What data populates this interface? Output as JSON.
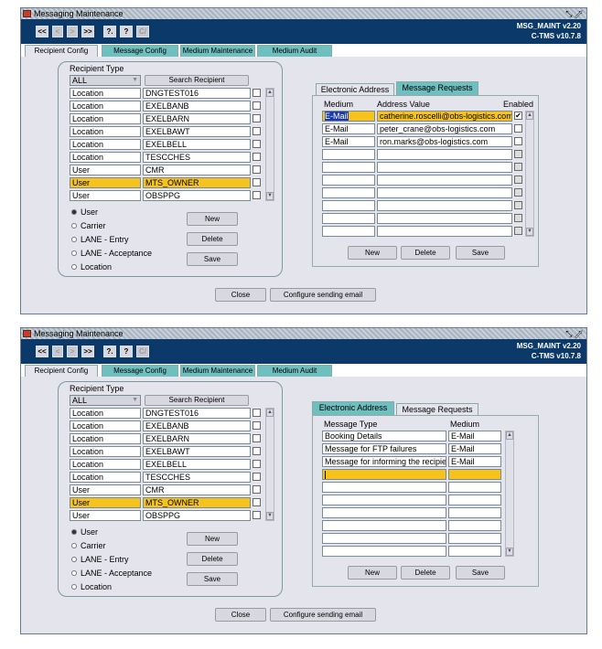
{
  "windows": [
    {
      "title": "Messaging Maintenance",
      "app_id": "MSG_MAINT v2.20",
      "app_version": "C-TMS v10.7.8",
      "toolbar_buttons": [
        "<<",
        "<",
        ">",
        ">>",
        "?.",
        "?",
        "C/"
      ],
      "tabs": [
        "Recipient Config",
        "Message Config",
        "Medium Maintenance",
        "Medium Audit"
      ],
      "recipient_type_label": "Recipient Type",
      "filter_value": "ALL",
      "search_button": "Search Recipient",
      "recipients": [
        {
          "type": "Location",
          "name": "DNGTEST016"
        },
        {
          "type": "Location",
          "name": "EXELBANB"
        },
        {
          "type": "Location",
          "name": "EXELBARN"
        },
        {
          "type": "Location",
          "name": "EXELBAWT"
        },
        {
          "type": "Location",
          "name": "EXELBELL"
        },
        {
          "type": "Location",
          "name": "TESCCHES"
        },
        {
          "type": "User",
          "name": "CMR"
        },
        {
          "type": "User",
          "name": "MTS_OWNER"
        },
        {
          "type": "User",
          "name": "OBSPPG"
        }
      ],
      "radios": [
        "User",
        "Carrier",
        "LANE - Entry",
        "LANE - Acceptance",
        "Location"
      ],
      "side_buttons": [
        "New",
        "Delete",
        "Save"
      ],
      "right_tabs": [
        "Electronic Address",
        "Message Requests"
      ],
      "right_headers": [
        "Medium",
        "Address Value",
        "Enabled"
      ],
      "right_rows": [
        {
          "c1": "E-Mail",
          "c2": "catherine.roscelli@obs-logistics.com"
        },
        {
          "c1": "E-Mail",
          "c2": "peter_crane@obs-logistics.com"
        },
        {
          "c1": "E-Mail",
          "c2": "ron.marks@obs-logistics.com"
        }
      ],
      "right_buttons": [
        "New",
        "Delete",
        "Save"
      ],
      "bottom_buttons": [
        "Close",
        "Configure sending email"
      ]
    },
    {
      "title": "Messaging Maintenance",
      "app_id": "MSG_MAINT v2.20",
      "app_version": "C-TMS v10.7.8",
      "toolbar_buttons": [
        "<<",
        "<",
        ">",
        ">>",
        "?.",
        "?",
        "C/"
      ],
      "tabs": [
        "Recipient Config",
        "Message Config",
        "Medium Maintenance",
        "Medium Audit"
      ],
      "recipient_type_label": "Recipient Type",
      "filter_value": "ALL",
      "search_button": "Search Recipient",
      "recipients": [
        {
          "type": "Location",
          "name": "DNGTEST016"
        },
        {
          "type": "Location",
          "name": "EXELBANB"
        },
        {
          "type": "Location",
          "name": "EXELBARN"
        },
        {
          "type": "Location",
          "name": "EXELBAWT"
        },
        {
          "type": "Location",
          "name": "EXELBELL"
        },
        {
          "type": "Location",
          "name": "TESCCHES"
        },
        {
          "type": "User",
          "name": "CMR"
        },
        {
          "type": "User",
          "name": "MTS_OWNER"
        },
        {
          "type": "User",
          "name": "OBSPPG"
        }
      ],
      "radios": [
        "User",
        "Carrier",
        "LANE - Entry",
        "LANE - Acceptance",
        "Location"
      ],
      "side_buttons": [
        "New",
        "Delete",
        "Save"
      ],
      "right_tabs": [
        "Electronic Address",
        "Message Requests"
      ],
      "right_headers": [
        "Message Type",
        "Medium"
      ],
      "right_rows": [
        {
          "c1": "Booking Details",
          "c2": "E-Mail"
        },
        {
          "c1": "Message for FTP failures",
          "c2": "E-Mail"
        },
        {
          "c1": "Message for informing the recipient",
          "c2": "E-Mail"
        }
      ],
      "right_buttons": [
        "New",
        "Delete",
        "Save"
      ],
      "bottom_buttons": [
        "Close",
        "Configure sending email"
      ]
    }
  ]
}
